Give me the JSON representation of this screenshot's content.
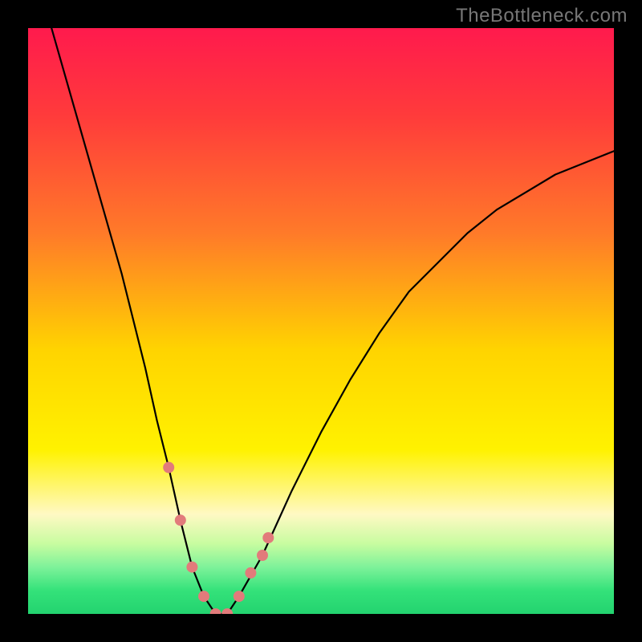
{
  "watermark": "TheBottleneck.com",
  "chart_data": {
    "type": "line",
    "title": "",
    "xlabel": "",
    "ylabel": "",
    "xlim": [
      0,
      100
    ],
    "ylim": [
      0,
      100
    ],
    "grid": false,
    "background_gradient_stops": [
      {
        "pos": 0.0,
        "color": "#ff1a4d"
      },
      {
        "pos": 0.15,
        "color": "#ff3b3b"
      },
      {
        "pos": 0.35,
        "color": "#ff7a29"
      },
      {
        "pos": 0.55,
        "color": "#ffd400"
      },
      {
        "pos": 0.72,
        "color": "#fff200"
      },
      {
        "pos": 0.83,
        "color": "#fff9c4"
      },
      {
        "pos": 0.88,
        "color": "#c8fca0"
      },
      {
        "pos": 0.92,
        "color": "#7ef29a"
      },
      {
        "pos": 0.96,
        "color": "#34e27a"
      },
      {
        "pos": 1.0,
        "color": "#23d36f"
      }
    ],
    "series": [
      {
        "name": "bottleneck-curve",
        "color": "#000000",
        "x": [
          4,
          8,
          12,
          16,
          20,
          22,
          24,
          26,
          28,
          30,
          32,
          34,
          36,
          40,
          45,
          50,
          55,
          60,
          65,
          70,
          75,
          80,
          85,
          90,
          95,
          100
        ],
        "y": [
          100,
          86,
          72,
          58,
          42,
          33,
          25,
          16,
          8,
          3,
          0,
          0,
          3,
          10,
          21,
          31,
          40,
          48,
          55,
          60,
          65,
          69,
          72,
          75,
          77,
          79
        ]
      }
    ],
    "markers": {
      "name": "highlight-dots",
      "color": "#e27b7b",
      "radius_px": 7,
      "points": [
        {
          "x": 24,
          "y": 25
        },
        {
          "x": 26,
          "y": 16
        },
        {
          "x": 28,
          "y": 8
        },
        {
          "x": 30,
          "y": 3
        },
        {
          "x": 32,
          "y": 0
        },
        {
          "x": 34,
          "y": 0
        },
        {
          "x": 36,
          "y": 3
        },
        {
          "x": 38,
          "y": 7
        },
        {
          "x": 40,
          "y": 10
        },
        {
          "x": 41,
          "y": 13
        }
      ]
    }
  }
}
